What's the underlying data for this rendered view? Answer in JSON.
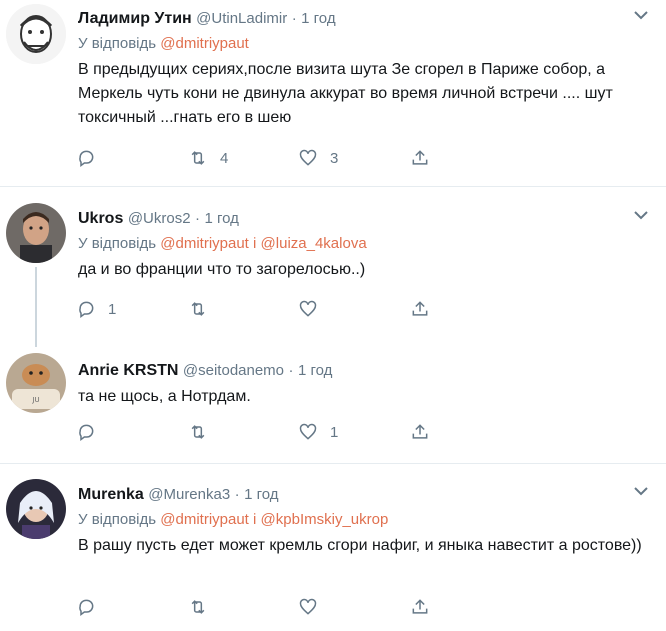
{
  "tweets": [
    {
      "name": "Ладимир Утин",
      "handle": "@UtinLadimir",
      "dot": "·",
      "time": "1 год",
      "reply_prefix": "У відповідь",
      "mention1": "@dmitriypaut",
      "and": "",
      "mention2": "",
      "text": "В предыдущих сериях,после визита шута Зе сгорел в Париже собор, а Меркель чуть кони не двинула аккурат во время личной встречи .... шут токсичный ...гнать его в шею",
      "reply_count": "",
      "retweet_count": "4",
      "like_count": "3"
    },
    {
      "name": "Ukros",
      "handle": "@Ukros2",
      "dot": "·",
      "time": "1 год",
      "reply_prefix": "У відповідь",
      "mention1": "@dmitriypaut",
      "and": "і",
      "mention2": "@luiza_4kalova",
      "text": "да и во франции что то загорелосью..)",
      "reply_count": "1",
      "retweet_count": "",
      "like_count": ""
    },
    {
      "name": "Anrie KRSTN",
      "handle": "@seitodanemo",
      "dot": "·",
      "time": "1 год",
      "text": "та не щось, а Нотрдам.",
      "reply_count": "",
      "retweet_count": "",
      "like_count": "1"
    },
    {
      "name": "Murenka",
      "handle": "@Murenka3",
      "dot": "·",
      "time": "1 год",
      "reply_prefix": "У відповідь",
      "mention1": "@dmitriypaut",
      "and": "і",
      "mention2": "@kpbImskiy_ukrop",
      "text": "В рашу пусть едет может кремль сгори нафиг, и яныка навестит а ростове))",
      "reply_count": "",
      "retweet_count": "",
      "like_count": ""
    }
  ],
  "icons": {
    "reply": "reply-icon",
    "retweet": "retweet-icon",
    "like": "heart-icon",
    "share": "share-icon",
    "more": "chevron-down-icon"
  },
  "colors": {
    "mention": "#e0704f",
    "secondary": "#657786",
    "divider": "#e6ecf0"
  }
}
